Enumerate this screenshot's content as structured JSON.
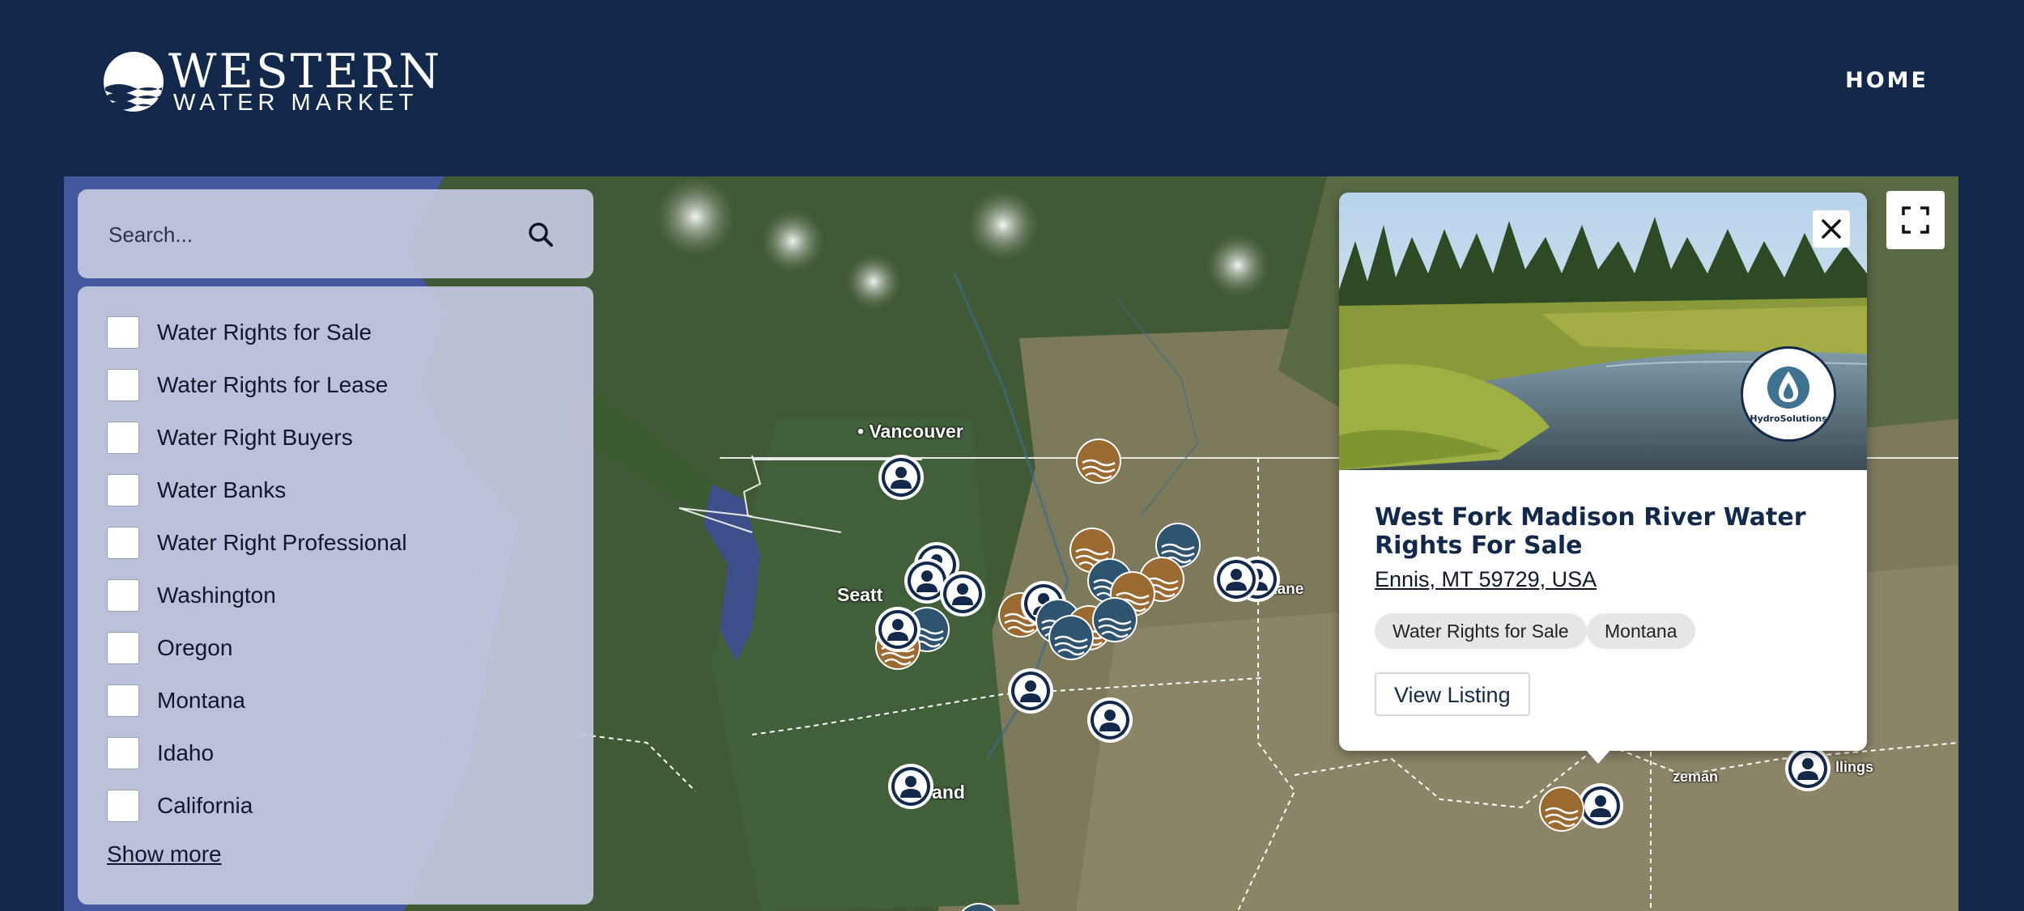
{
  "header": {
    "logo_line1": "WESTERN",
    "logo_line2": "WATER MARKET",
    "nav_home": "HOME"
  },
  "search": {
    "placeholder": "Search..."
  },
  "filters": {
    "items": [
      "Water Rights for Sale",
      "Water Rights for Lease",
      "Water Right Buyers",
      "Water Banks",
      "Water Right Professional",
      "Washington",
      "Oregon",
      "Montana",
      "Idaho",
      "California"
    ],
    "show_more": "Show more"
  },
  "map": {
    "labels": {
      "vancouver": "Vancouver",
      "seattle": "Seatt",
      "portland": "ortland",
      "spokane": "kane",
      "bozeman": "zeman",
      "billings": "llings"
    },
    "marker_colors": {
      "navy": "#13294b",
      "brown": "#9a6a30",
      "steel": "#2e5470"
    }
  },
  "popup": {
    "company_logo_text": "HydroSolutions",
    "title": "West Fork Madison River Water Rights For Sale",
    "address": "Ennis, MT 59729, USA",
    "tags": [
      "Water Rights for Sale",
      "Montana"
    ],
    "view_button": "View Listing"
  },
  "colors": {
    "brand_navy": "#13294b",
    "panel_bg": "#c5c9e0"
  }
}
